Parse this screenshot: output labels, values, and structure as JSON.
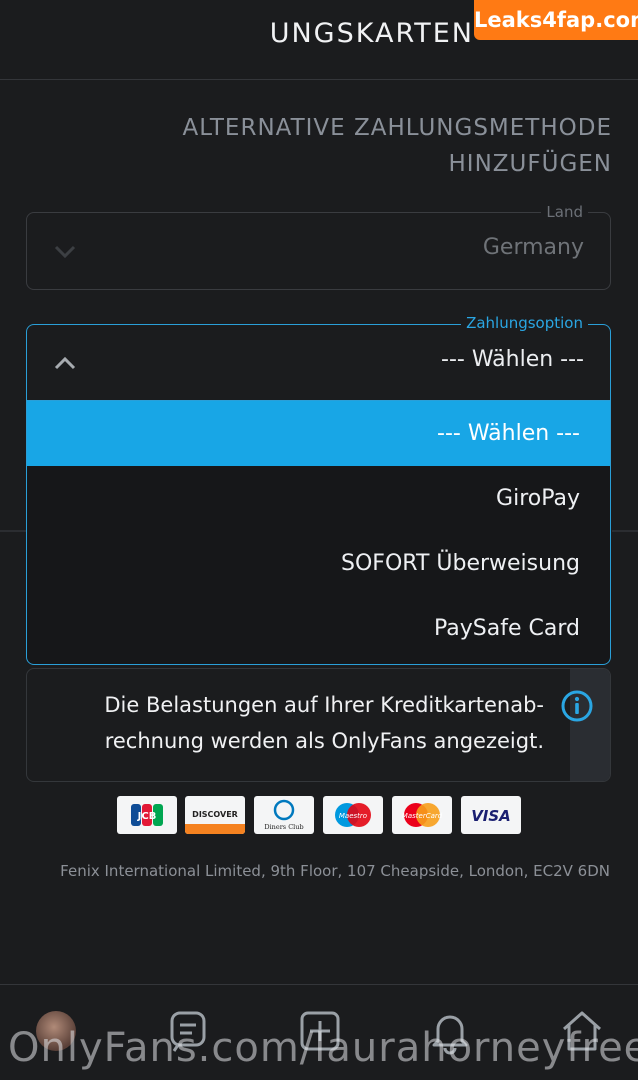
{
  "header": {
    "title": "UNGSKARTEN",
    "watermark": "Leaks4fap.com"
  },
  "section": {
    "title": "ALTERNATIVE ZAHLUNGSMETHODE HINZUFÜGEN"
  },
  "land": {
    "legend": "Land",
    "value": "Germany"
  },
  "payment_option": {
    "legend": "Zahlungsoption",
    "value": "--- Wählen ---",
    "options": [
      "--- Wählen ---",
      "GiroPay",
      "SOFORT Überweisung",
      "PaySafe Card"
    ],
    "selected_index": 0
  },
  "info": {
    "text": "Die Belastungen auf Ihrer Kreditkartenab-rechnung werden als OnlyFans angezeigt."
  },
  "cards": [
    "VISA",
    "MasterCard",
    "Maestro",
    "Diners Club",
    "DISCOVER",
    "JCB"
  ],
  "footer": {
    "address": "Fenix International Limited, 9th Floor, 107 Cheapside, London, EC2V 6DN"
  },
  "watermark_bottom": "OnlyFans.com/laurahorneyfree",
  "colors": {
    "accent": "#18a6e6",
    "background": "#1b1c1e"
  },
  "nav_icons": [
    "home-icon",
    "bell-icon",
    "add-post-icon",
    "messages-icon",
    "avatar"
  ]
}
